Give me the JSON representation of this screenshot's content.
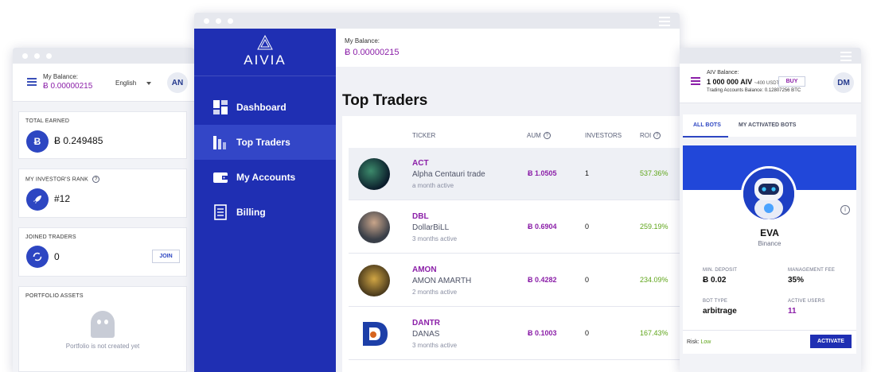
{
  "left_window": {
    "balance_label": "My Balance:",
    "balance_value": "Ƀ 0.00000215",
    "language": "English",
    "avatar_initials": "AN",
    "total_earned": {
      "label": "TOTAL EARNED",
      "value": "Ƀ 0.249485",
      "icon": "bitcoin-icon"
    },
    "rank": {
      "label": "MY INVESTOR'S RANK",
      "value": "#12",
      "icon": "rocket-icon"
    },
    "joined": {
      "label": "JOINED TRADERS",
      "value": "0",
      "button": "JOIN",
      "icon": "sync-icon"
    },
    "portfolio": {
      "label": "PORTFOLIO ASSETS",
      "empty_text": "Portfolio is not created yet",
      "icon": "ghost-icon"
    }
  },
  "center_window": {
    "logo": "AIVIA",
    "nav": [
      {
        "label": "Dashboard",
        "icon": "dashboard-icon",
        "active": false
      },
      {
        "label": "Top Traders",
        "icon": "bar-chart-icon",
        "active": true
      },
      {
        "label": "My Accounts",
        "icon": "wallet-icon",
        "active": false
      },
      {
        "label": "Billing",
        "icon": "receipt-icon",
        "active": false
      }
    ],
    "balance_label": "My Balance:",
    "balance_value": "Ƀ 0.00000215",
    "title": "Top Traders",
    "columns": {
      "ticker": "TICKER",
      "aum": "AUM",
      "investors": "INVESTORS",
      "roi": "ROI"
    },
    "traders": [
      {
        "ticker": "ACT",
        "name": "Alpha Centauri trade",
        "active": "a month active",
        "aum": "Ƀ 1.0505",
        "investors": "1",
        "roi": "537.36%"
      },
      {
        "ticker": "DBL",
        "name": "DollarBiLL",
        "active": "3 months active",
        "aum": "Ƀ 0.6904",
        "investors": "0",
        "roi": "259.19%"
      },
      {
        "ticker": "AMON",
        "name": "AMON AMARTH",
        "active": "2 months active",
        "aum": "Ƀ 0.4282",
        "investors": "0",
        "roi": "234.09%"
      },
      {
        "ticker": "DANTR",
        "name": "DANAS",
        "active": "3 months active",
        "aum": "Ƀ 0.1003",
        "investors": "0",
        "roi": "167.43%"
      }
    ]
  },
  "right_window": {
    "aiv_label": "AIV Balance:",
    "aiv_value": "1 000 000 AIV",
    "aiv_usd": "~400 USDT",
    "buy_label": "BUY",
    "trading_balance": "Trading Accounts Balance: 0.12807256 BTC",
    "avatar_initials": "DM",
    "tabs": [
      "ALL BOTS",
      "MY ACTIVATED BOTS"
    ],
    "bot": {
      "name": "EVA",
      "exchange": "Binance",
      "min_deposit_label": "MIN. DEPOSIT",
      "min_deposit": "Ƀ 0.02",
      "fee_label": "MANAGEMENT FEE",
      "fee": "35%",
      "type_label": "BOT TYPE",
      "type": "arbitrage",
      "users_label": "ACTIVE USERS",
      "users": "11",
      "risk_label": "Risk:",
      "risk": "Low",
      "activate_label": "ACTIVATE"
    }
  },
  "colors": {
    "primary": "#1f2fb3",
    "accent": "#8b1fa8",
    "positive": "#5fa51a"
  }
}
